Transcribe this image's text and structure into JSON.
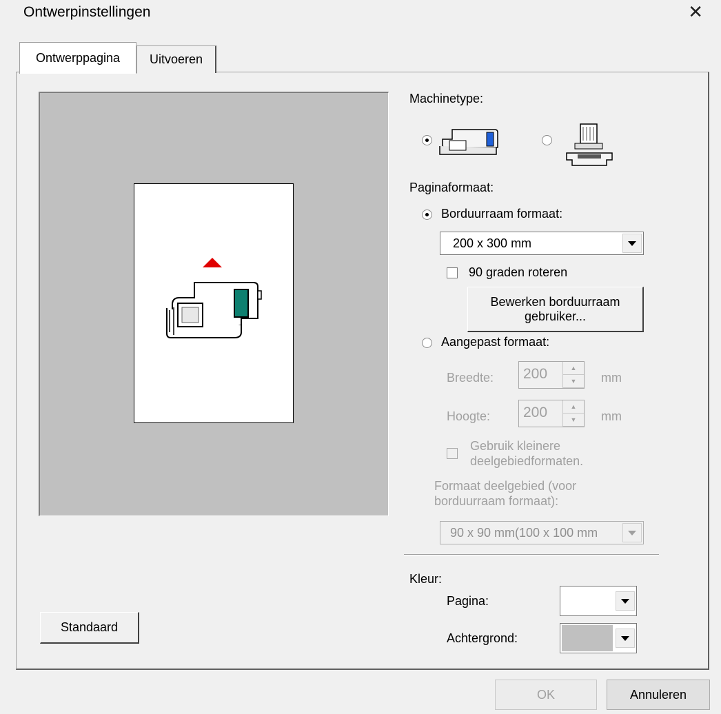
{
  "window": {
    "title": "Ontwerpinstellingen",
    "close_glyph": "✕"
  },
  "tabs": [
    {
      "label": "Ontwerppagina",
      "active": true
    },
    {
      "label": "Uitvoeren",
      "active": false
    }
  ],
  "machine": {
    "label": "Machinetype:",
    "selected": "embroidery-sewing-machine"
  },
  "page_size": {
    "label": "Paginaformaat:",
    "hoop_radio_label": "Borduurraam formaat:",
    "hoop_value": "200 x 300 mm",
    "rotate_label": "90 graden roteren",
    "edit_hoop_button": "Bewerken borduurraam gebruiker...",
    "custom_radio_label": "Aangepast formaat:",
    "width_label": "Breedte:",
    "width_value": "200",
    "height_label": "Hoogte:",
    "height_value": "200",
    "unit": "mm",
    "small_sections_label": "Gebruik kleinere deelgebiedformaten.",
    "section_size_label": "Formaat deelgebied (voor borduurraam formaat):",
    "section_size_value": "90 x  90 mm(100 x 100 mm"
  },
  "color": {
    "label": "Kleur:",
    "page_label": "Pagina:",
    "page_color": "#ffffff",
    "background_label": "Achtergrond:",
    "background_color": "#c0c0c0"
  },
  "buttons": {
    "default": "Standaard",
    "ok": "OK",
    "cancel": "Annuleren"
  }
}
